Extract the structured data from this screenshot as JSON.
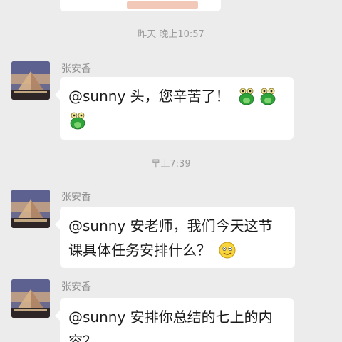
{
  "timestamps": [
    "昨天 晚上10:57",
    "早上7:39"
  ],
  "messages": [
    {
      "sender": "张安香",
      "lines": [
        "@sunny  头，您辛苦了！"
      ],
      "emoji": "frog-emoji"
    },
    {
      "sender": "张安香",
      "lines": [
        "@sunny  安老师，我们今天这节",
        "课具体任务安排什么？"
      ],
      "emoji": "smiley-emoji"
    },
    {
      "sender": "张安香",
      "lines": [
        "@sunny  安排你总结的七上的内",
        "容？"
      ]
    }
  ],
  "colors": {
    "background": "#ececec",
    "bubble": "#ffffff",
    "timestamp_text": "#9b9b9b",
    "sender_text": "#8e8e8e",
    "message_text": "#1a1a1a"
  }
}
